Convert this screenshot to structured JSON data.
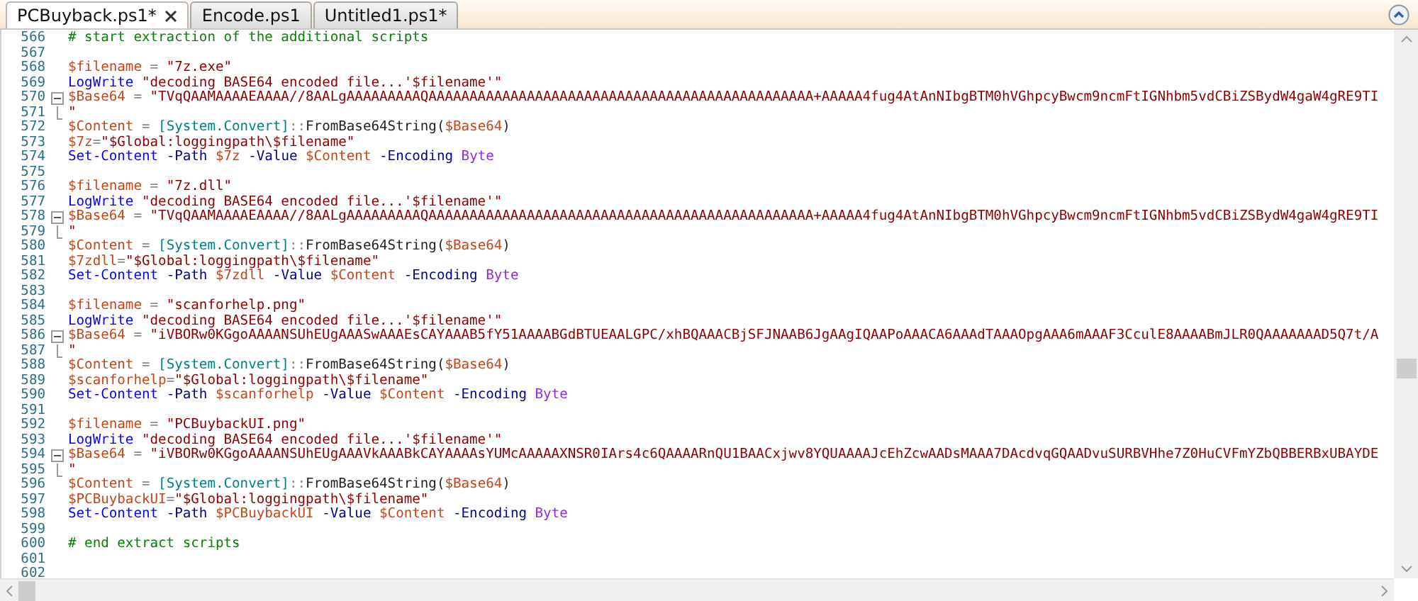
{
  "tabs": [
    {
      "label": "PCBuyback.ps1*",
      "selected": true,
      "closable": true
    },
    {
      "label": "Encode.ps1",
      "selected": false,
      "closable": false
    },
    {
      "label": "Untitled1.ps1*",
      "selected": false,
      "closable": false
    }
  ],
  "editor": {
    "lines": [
      {
        "number": "566",
        "tokens": [
          {
            "kind": "comment",
            "text": "# start extraction of the additional scripts"
          }
        ]
      },
      {
        "number": "567"
      },
      {
        "number": "568",
        "tokens": [
          {
            "kind": "variable",
            "text": "$filename"
          },
          {
            "kind": "operator",
            "text": " = "
          },
          {
            "kind": "string",
            "text": "\"7z.exe\""
          }
        ]
      },
      {
        "number": "569",
        "tokens": [
          {
            "kind": "command",
            "text": "LogWrite"
          },
          {
            "kind": "string",
            "text": " \"decoding BASE64 encoded file...'$filename'\""
          }
        ]
      },
      {
        "number": "570",
        "collapsible": true,
        "tokens": [
          {
            "kind": "variable",
            "text": "$Base64"
          },
          {
            "kind": "operator",
            "text": " = "
          },
          {
            "kind": "string",
            "text": "\"TVqQAAMAAAAEAAAA//8AALgAAAAAAAAAQAAAAAAAAAAAAAAAAAAAAAAAAAAAAAAAAAAAAAAAAAAAAAAA+AAAAA4fug4AtAnNIbgBTM0hVGhpcyBwcm9ncmFtIGNhbm5vdCBiZSBydW4gaW4gRE9TI"
          }
        ]
      },
      {
        "number": "571",
        "fold_end": true,
        "tokens": [
          {
            "kind": "string",
            "text": "\""
          }
        ]
      },
      {
        "number": "572",
        "tokens": [
          {
            "kind": "variable",
            "text": "$Content"
          },
          {
            "kind": "operator",
            "text": " = "
          },
          {
            "kind": "type",
            "text": "[System.Convert]"
          },
          {
            "kind": "operator",
            "text": "::"
          },
          {
            "kind": "member",
            "text": "FromBase64String"
          },
          {
            "kind": "plain",
            "text": "("
          },
          {
            "kind": "variable",
            "text": "$Base64"
          },
          {
            "kind": "plain",
            "text": ")"
          }
        ]
      },
      {
        "number": "573",
        "tokens": [
          {
            "kind": "variable",
            "text": "$7z"
          },
          {
            "kind": "operator",
            "text": "="
          },
          {
            "kind": "string",
            "text": "\"$Global:loggingpath\\$filename\""
          }
        ]
      },
      {
        "number": "574",
        "tokens": [
          {
            "kind": "command",
            "text": "Set-Content"
          },
          {
            "kind": "parameter",
            "text": " -Path "
          },
          {
            "kind": "variable",
            "text": "$7z"
          },
          {
            "kind": "parameter",
            "text": " -Value "
          },
          {
            "kind": "variable",
            "text": "$Content"
          },
          {
            "kind": "parameter",
            "text": " -Encoding "
          },
          {
            "kind": "argument",
            "text": "Byte"
          }
        ]
      },
      {
        "number": "575"
      },
      {
        "number": "576",
        "tokens": [
          {
            "kind": "variable",
            "text": "$filename"
          },
          {
            "kind": "operator",
            "text": " = "
          },
          {
            "kind": "string",
            "text": "\"7z.dll\""
          }
        ]
      },
      {
        "number": "577",
        "tokens": [
          {
            "kind": "command",
            "text": "LogWrite"
          },
          {
            "kind": "string",
            "text": " \"decoding BASE64 encoded file...'$filename'\""
          }
        ]
      },
      {
        "number": "578",
        "collapsible": true,
        "tokens": [
          {
            "kind": "variable",
            "text": "$Base64"
          },
          {
            "kind": "operator",
            "text": " = "
          },
          {
            "kind": "string",
            "text": "\"TVqQAAMAAAAEAAAA//8AALgAAAAAAAAAQAAAAAAAAAAAAAAAAAAAAAAAAAAAAAAAAAAAAAAAAAAAAAAA+AAAAA4fug4AtAnNIbgBTM0hVGhpcyBwcm9ncmFtIGNhbm5vdCBiZSBydW4gaW4gRE9TI"
          }
        ]
      },
      {
        "number": "579",
        "fold_end": true,
        "tokens": [
          {
            "kind": "string",
            "text": "\""
          }
        ]
      },
      {
        "number": "580",
        "tokens": [
          {
            "kind": "variable",
            "text": "$Content"
          },
          {
            "kind": "operator",
            "text": " = "
          },
          {
            "kind": "type",
            "text": "[System.Convert]"
          },
          {
            "kind": "operator",
            "text": "::"
          },
          {
            "kind": "member",
            "text": "FromBase64String"
          },
          {
            "kind": "plain",
            "text": "("
          },
          {
            "kind": "variable",
            "text": "$Base64"
          },
          {
            "kind": "plain",
            "text": ")"
          }
        ]
      },
      {
        "number": "581",
        "tokens": [
          {
            "kind": "variable",
            "text": "$7zdll"
          },
          {
            "kind": "operator",
            "text": "="
          },
          {
            "kind": "string",
            "text": "\"$Global:loggingpath\\$filename\""
          }
        ]
      },
      {
        "number": "582",
        "tokens": [
          {
            "kind": "command",
            "text": "Set-Content"
          },
          {
            "kind": "parameter",
            "text": " -Path "
          },
          {
            "kind": "variable",
            "text": "$7zdll"
          },
          {
            "kind": "parameter",
            "text": " -Value "
          },
          {
            "kind": "variable",
            "text": "$Content"
          },
          {
            "kind": "parameter",
            "text": " -Encoding "
          },
          {
            "kind": "argument",
            "text": "Byte"
          }
        ]
      },
      {
        "number": "583"
      },
      {
        "number": "584",
        "tokens": [
          {
            "kind": "variable",
            "text": "$filename"
          },
          {
            "kind": "operator",
            "text": " = "
          },
          {
            "kind": "string",
            "text": "\"scanforhelp.png\""
          }
        ]
      },
      {
        "number": "585",
        "tokens": [
          {
            "kind": "command",
            "text": "LogWrite"
          },
          {
            "kind": "string",
            "text": " \"decoding BASE64 encoded file...'$filename'\""
          }
        ]
      },
      {
        "number": "586",
        "collapsible": true,
        "tokens": [
          {
            "kind": "variable",
            "text": "$Base64"
          },
          {
            "kind": "operator",
            "text": " = "
          },
          {
            "kind": "string",
            "text": "\"iVBORw0KGgoAAAANSUhEUgAAASwAAAEsCAYAAAB5fY51AAAABGdBTUEAALGPC/xhBQAAACBjSFJNAAB6JgAAgIQAAPoAAACA6AAAdTAAAOpgAAA6mAAAF3CculE8AAAABmJLR0QAAAAAAAD5Q7t/A"
          }
        ]
      },
      {
        "number": "587",
        "fold_end": true,
        "tokens": [
          {
            "kind": "string",
            "text": "\""
          }
        ]
      },
      {
        "number": "588",
        "tokens": [
          {
            "kind": "variable",
            "text": "$Content"
          },
          {
            "kind": "operator",
            "text": " = "
          },
          {
            "kind": "type",
            "text": "[System.Convert]"
          },
          {
            "kind": "operator",
            "text": "::"
          },
          {
            "kind": "member",
            "text": "FromBase64String"
          },
          {
            "kind": "plain",
            "text": "("
          },
          {
            "kind": "variable",
            "text": "$Base64"
          },
          {
            "kind": "plain",
            "text": ")"
          }
        ]
      },
      {
        "number": "589",
        "tokens": [
          {
            "kind": "variable",
            "text": "$scanforhelp"
          },
          {
            "kind": "operator",
            "text": "="
          },
          {
            "kind": "string",
            "text": "\"$Global:loggingpath\\$filename\""
          }
        ]
      },
      {
        "number": "590",
        "tokens": [
          {
            "kind": "command",
            "text": "Set-Content"
          },
          {
            "kind": "parameter",
            "text": " -Path "
          },
          {
            "kind": "variable",
            "text": "$scanforhelp"
          },
          {
            "kind": "parameter",
            "text": " -Value "
          },
          {
            "kind": "variable",
            "text": "$Content"
          },
          {
            "kind": "parameter",
            "text": " -Encoding "
          },
          {
            "kind": "argument",
            "text": "Byte"
          }
        ]
      },
      {
        "number": "591"
      },
      {
        "number": "592",
        "tokens": [
          {
            "kind": "variable",
            "text": "$filename"
          },
          {
            "kind": "operator",
            "text": " = "
          },
          {
            "kind": "string",
            "text": "\"PCBuybackUI.png\""
          }
        ]
      },
      {
        "number": "593",
        "tokens": [
          {
            "kind": "command",
            "text": "LogWrite"
          },
          {
            "kind": "string",
            "text": " \"decoding BASE64 encoded file...'$filename'\""
          }
        ]
      },
      {
        "number": "594",
        "collapsible": true,
        "tokens": [
          {
            "kind": "variable",
            "text": "$Base64"
          },
          {
            "kind": "operator",
            "text": " = "
          },
          {
            "kind": "string",
            "text": "\"iVBORw0KGgoAAAANSUhEUgAAAVkAAABkCAYAAAAsYUMcAAAAAXNSR0IArs4c6QAAAARnQU1BAACxjwv8YQUAAAAJcEhZcwAADsMAAA7DAcdvqGQAADvuSURBVHhe7Z0HuCVFmYZbQBBERBxUBAYDE"
          }
        ]
      },
      {
        "number": "595",
        "fold_end": true,
        "tokens": [
          {
            "kind": "string",
            "text": "\""
          }
        ]
      },
      {
        "number": "596",
        "tokens": [
          {
            "kind": "variable",
            "text": "$Content"
          },
          {
            "kind": "operator",
            "text": " = "
          },
          {
            "kind": "type",
            "text": "[System.Convert]"
          },
          {
            "kind": "operator",
            "text": "::"
          },
          {
            "kind": "member",
            "text": "FromBase64String"
          },
          {
            "kind": "plain",
            "text": "("
          },
          {
            "kind": "variable",
            "text": "$Base64"
          },
          {
            "kind": "plain",
            "text": ")"
          }
        ]
      },
      {
        "number": "597",
        "tokens": [
          {
            "kind": "variable",
            "text": "$PCBuybackUI"
          },
          {
            "kind": "operator",
            "text": "="
          },
          {
            "kind": "string",
            "text": "\"$Global:loggingpath\\$filename\""
          }
        ]
      },
      {
        "number": "598",
        "tokens": [
          {
            "kind": "command",
            "text": "Set-Content"
          },
          {
            "kind": "parameter",
            "text": " -Path "
          },
          {
            "kind": "variable",
            "text": "$PCBuybackUI"
          },
          {
            "kind": "parameter",
            "text": " -Value "
          },
          {
            "kind": "variable",
            "text": "$Content"
          },
          {
            "kind": "parameter",
            "text": " -Encoding "
          },
          {
            "kind": "argument",
            "text": "Byte"
          }
        ]
      },
      {
        "number": "599"
      },
      {
        "number": "600",
        "tokens": [
          {
            "kind": "comment",
            "text": "# end extract scripts"
          }
        ]
      },
      {
        "number": "601"
      },
      {
        "number": "602"
      }
    ]
  }
}
